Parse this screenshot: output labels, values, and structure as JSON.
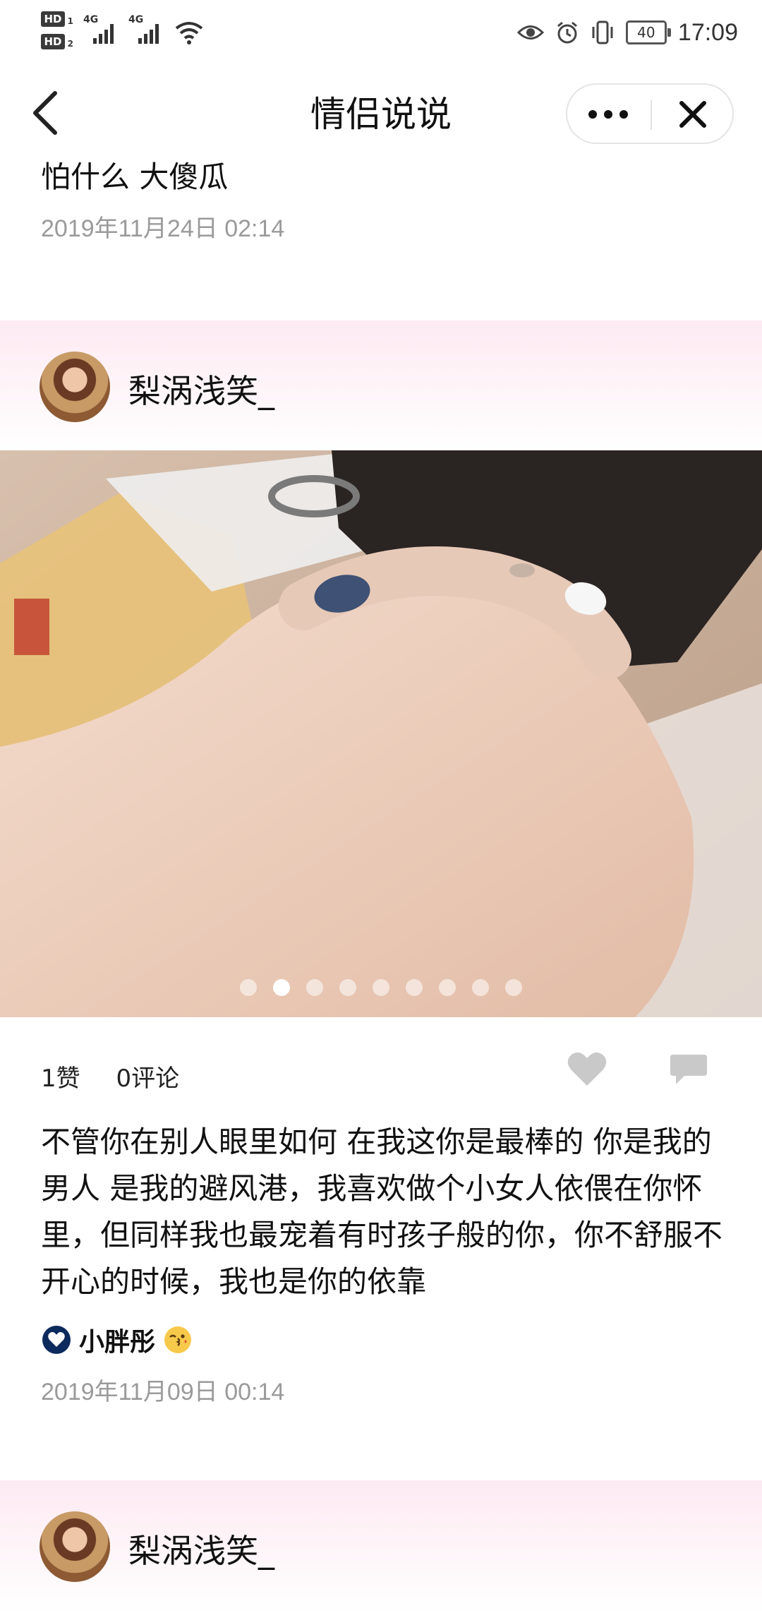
{
  "status_bar": {
    "sim1": "HD",
    "sim1_index": "1",
    "sim2": "HD",
    "sim2_index": "2",
    "network1": "4G",
    "network2": "4G",
    "battery": "40",
    "time": "17:09"
  },
  "nav": {
    "title": "情侣说说",
    "icons": [
      "back-icon",
      "more-icon",
      "close-icon"
    ]
  },
  "posts": [
    {
      "text": "怕什么 大傻瓜",
      "time": "2019年11月24日 02:14"
    },
    {
      "author": "梨涡浅笑_",
      "image_count": 9,
      "active_image": 2,
      "likes": "1赞",
      "comments": "0评论",
      "text": "不管你在别人眼里如何 在我这你是最棒的 你是我的男人 是我的避风港，我喜欢做个小女人依偎在你怀里，但同样我也最宠着有时孩子般的你，你不舒服不开心的时候，我也是你的依靠",
      "partner": "小胖彤",
      "time": "2019年11月09日 00:14"
    },
    {
      "author": "梨涡浅笑_"
    }
  ],
  "colors": {
    "band_pink": "#fdeaf2",
    "timestamp_gray": "#9a9a9a",
    "heart_badge": "#0d2a5c"
  }
}
